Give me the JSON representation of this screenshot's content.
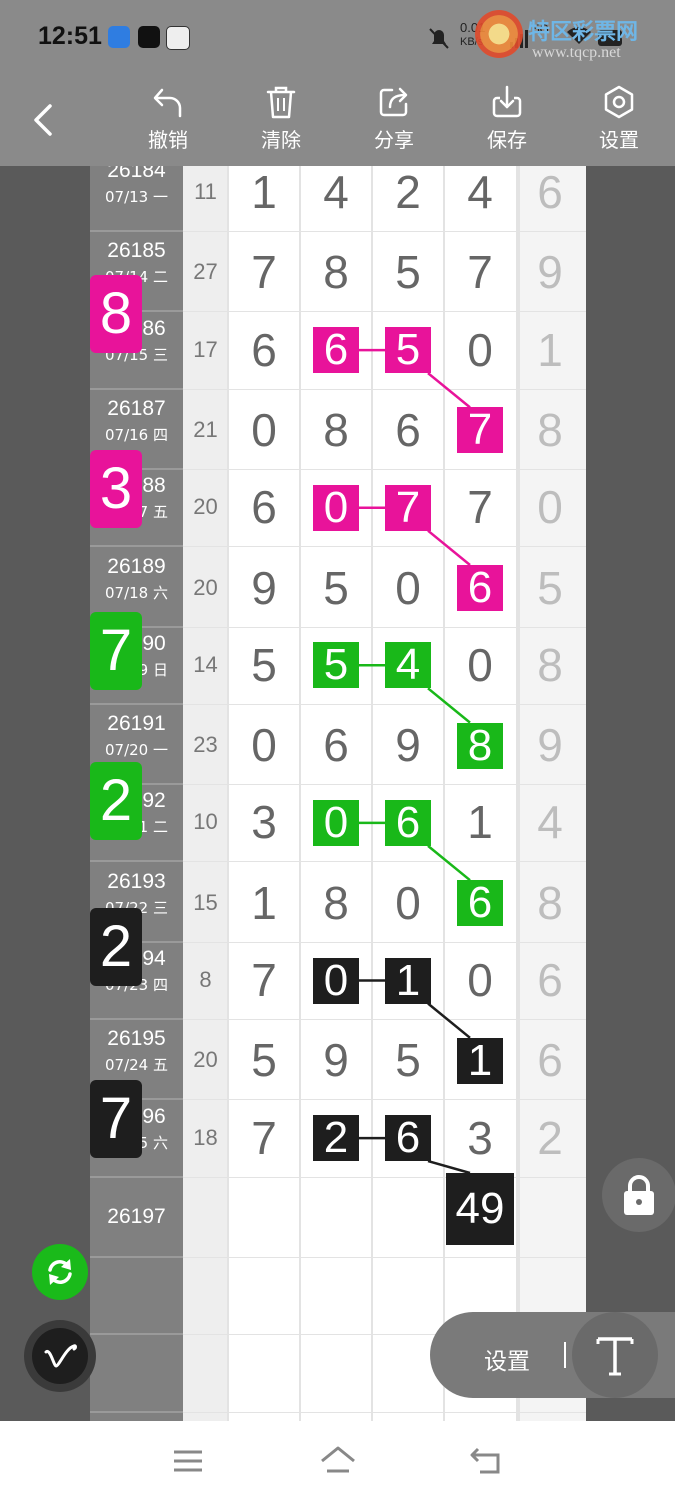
{
  "status_bar": {
    "time": "12:51",
    "net_speed": "0.01",
    "net_unit": "KB/s",
    "signal": "5G"
  },
  "watermark": {
    "name": "特区彩票网",
    "url": "www.tqcp.net"
  },
  "toolbar": {
    "undo": "撤销",
    "clear": "清除",
    "share": "分享",
    "save": "保存",
    "settings": "设置"
  },
  "grid": {
    "rows": [
      {
        "issue": "26184",
        "date": "07/13 一",
        "sum": "11",
        "d": [
          "1",
          "4",
          "2",
          "4",
          "6"
        ]
      },
      {
        "issue": "26185",
        "date": "07/14 二",
        "sum": "27",
        "d": [
          "7",
          "8",
          "5",
          "7",
          "9"
        ]
      },
      {
        "issue": "26186",
        "date": "07/15 三",
        "sum": "17",
        "d": [
          "6",
          "6",
          "5",
          "0",
          "1"
        ]
      },
      {
        "issue": "26187",
        "date": "07/16 四",
        "sum": "21",
        "d": [
          "0",
          "8",
          "6",
          "7",
          "8"
        ]
      },
      {
        "issue": "26188",
        "date": "07/17 五",
        "sum": "20",
        "d": [
          "6",
          "0",
          "7",
          "7",
          "0"
        ]
      },
      {
        "issue": "26189",
        "date": "07/18 六",
        "sum": "20",
        "d": [
          "9",
          "5",
          "0",
          "6",
          "5"
        ]
      },
      {
        "issue": "26190",
        "date": "07/19 日",
        "sum": "14",
        "d": [
          "5",
          "5",
          "4",
          "0",
          "8"
        ]
      },
      {
        "issue": "26191",
        "date": "07/20 一",
        "sum": "23",
        "d": [
          "0",
          "6",
          "9",
          "8",
          "9"
        ]
      },
      {
        "issue": "26192",
        "date": "07/21 二",
        "sum": "10",
        "d": [
          "3",
          "0",
          "6",
          "1",
          "4"
        ]
      },
      {
        "issue": "26193",
        "date": "07/22 三",
        "sum": "15",
        "d": [
          "1",
          "8",
          "0",
          "6",
          "8"
        ]
      },
      {
        "issue": "26194",
        "date": "07/23 四",
        "sum": "8",
        "d": [
          "7",
          "0",
          "1",
          "0",
          "6"
        ]
      },
      {
        "issue": "26195",
        "date": "07/24 五",
        "sum": "20",
        "d": [
          "5",
          "9",
          "5",
          "1",
          "6"
        ]
      },
      {
        "issue": "26196",
        "date": "07/25 六",
        "sum": "18",
        "d": [
          "7",
          "2",
          "6",
          "3",
          "2"
        ]
      },
      {
        "issue": "26197",
        "date": "",
        "sum": "",
        "d": [
          "",
          "",
          "",
          "",
          ""
        ]
      }
    ],
    "prediction": "49"
  },
  "badges": [
    {
      "value": "8",
      "color": "#e8139a"
    },
    {
      "value": "3",
      "color": "#e8139a"
    },
    {
      "value": "7",
      "color": "#19b819"
    },
    {
      "value": "2",
      "color": "#19b819"
    },
    {
      "value": "2",
      "color": "#1e1e1e"
    },
    {
      "value": "7",
      "color": "#1e1e1e"
    }
  ],
  "highlight_colors": {
    "pink": "#e8139a",
    "green": "#19b819",
    "black": "#1e1e1e"
  },
  "floating": {
    "settings_pill": "设置"
  },
  "icons": [
    "back-icon",
    "undo-icon",
    "trash-icon",
    "share-icon",
    "download-icon",
    "settings-hex-icon",
    "refresh-icon",
    "pen-icon",
    "lock-icon",
    "text-tool-icon",
    "menu-icon",
    "home-icon",
    "back-nav-icon"
  ]
}
